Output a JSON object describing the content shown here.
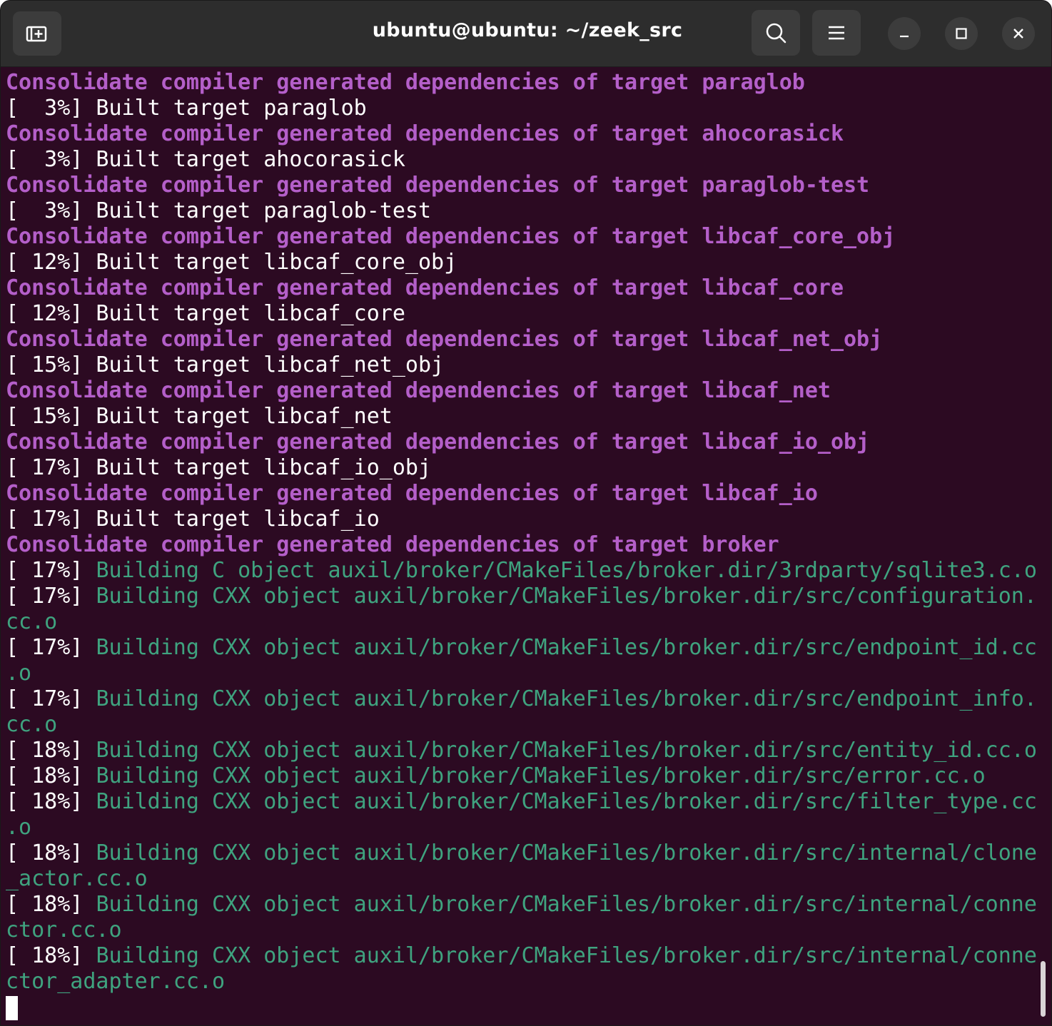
{
  "window": {
    "title": "ubuntu@ubuntu: ~/zeek_src"
  },
  "icons": {
    "new_tab": "new-tab-icon",
    "search": "search-icon",
    "menu": "hamburger-menu-icon",
    "minimize": "minimize-icon",
    "maximize": "maximize-icon",
    "close": "close-icon"
  },
  "colors": {
    "background": "#2c0a22",
    "consolidate": "#b45fc9",
    "building": "#3fa37f",
    "default_text": "#ffffff"
  },
  "terminal": {
    "lines": [
      {
        "prefix": "",
        "text": "Consolidate compiler generated dependencies of target paraglob"
      },
      {
        "prefix": "",
        "text": "[  3%] Built target paraglob"
      },
      {
        "prefix": "",
        "text": "Consolidate compiler generated dependencies of target ahocorasick"
      },
      {
        "prefix": "",
        "text": "[  3%] Built target ahocorasick"
      },
      {
        "prefix": "",
        "text": "Consolidate compiler generated dependencies of target paraglob-test"
      },
      {
        "prefix": "",
        "text": "[  3%] Built target paraglob-test"
      },
      {
        "prefix": "",
        "text": "Consolidate compiler generated dependencies of target libcaf_core_obj"
      },
      {
        "prefix": "",
        "text": "[ 12%] Built target libcaf_core_obj"
      },
      {
        "prefix": "",
        "text": "Consolidate compiler generated dependencies of target libcaf_core"
      },
      {
        "prefix": "",
        "text": "[ 12%] Built target libcaf_core"
      },
      {
        "prefix": "",
        "text": "Consolidate compiler generated dependencies of target libcaf_net_obj"
      },
      {
        "prefix": "",
        "text": "[ 15%] Built target libcaf_net_obj"
      },
      {
        "prefix": "",
        "text": "Consolidate compiler generated dependencies of target libcaf_net"
      },
      {
        "prefix": "",
        "text": "[ 15%] Built target libcaf_net"
      },
      {
        "prefix": "",
        "text": "Consolidate compiler generated dependencies of target libcaf_io_obj"
      },
      {
        "prefix": "",
        "text": "[ 17%] Built target libcaf_io_obj"
      },
      {
        "prefix": "",
        "text": "Consolidate compiler generated dependencies of target libcaf_io"
      },
      {
        "prefix": "",
        "text": "[ 17%] Built target libcaf_io"
      },
      {
        "prefix": "",
        "text": "Consolidate compiler generated dependencies of target broker"
      },
      {
        "prefix": "[ 17%] ",
        "text": "Building C object auxil/broker/CMakeFiles/broker.dir/3rdparty/sqlite3.c.o"
      },
      {
        "prefix": "[ 17%] ",
        "text": "Building CXX object auxil/broker/CMakeFiles/broker.dir/src/configuration."
      },
      {
        "prefix": "",
        "text": "cc.o"
      },
      {
        "prefix": "[ 17%] ",
        "text": "Building CXX object auxil/broker/CMakeFiles/broker.dir/src/endpoint_id.cc"
      },
      {
        "prefix": "",
        "text": ".o"
      },
      {
        "prefix": "[ 17%] ",
        "text": "Building CXX object auxil/broker/CMakeFiles/broker.dir/src/endpoint_info."
      },
      {
        "prefix": "",
        "text": "cc.o"
      },
      {
        "prefix": "[ 18%] ",
        "text": "Building CXX object auxil/broker/CMakeFiles/broker.dir/src/entity_id.cc.o"
      },
      {
        "prefix": "[ 18%] ",
        "text": "Building CXX object auxil/broker/CMakeFiles/broker.dir/src/error.cc.o"
      },
      {
        "prefix": "[ 18%] ",
        "text": "Building CXX object auxil/broker/CMakeFiles/broker.dir/src/filter_type.cc"
      },
      {
        "prefix": "",
        "text": ".o"
      },
      {
        "prefix": "[ 18%] ",
        "text": "Building CXX object auxil/broker/CMakeFiles/broker.dir/src/internal/clone"
      },
      {
        "prefix": "",
        "text": "_actor.cc.o"
      },
      {
        "prefix": "[ 18%] ",
        "text": "Building CXX object auxil/broker/CMakeFiles/broker.dir/src/internal/conne"
      },
      {
        "prefix": "",
        "text": "ctor.cc.o"
      },
      {
        "prefix": "[ 18%] ",
        "text": "Building CXX object auxil/broker/CMakeFiles/broker.dir/src/internal/conne"
      },
      {
        "prefix": "",
        "text": "ctor_adapter.cc.o"
      }
    ]
  }
}
